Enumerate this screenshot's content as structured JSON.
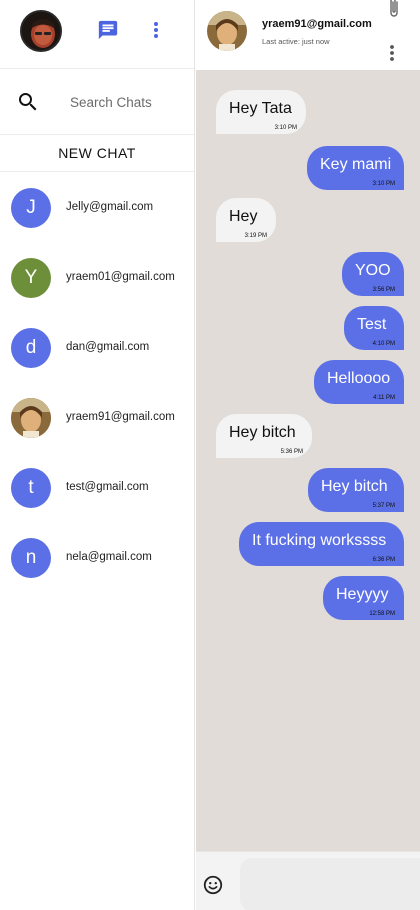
{
  "sidebar": {
    "search_placeholder": "Search Chats",
    "new_chat_label": "NEW CHAT",
    "items": [
      {
        "initial": "J",
        "label": "Jelly@gmail.com",
        "color": "#5b6fe6",
        "photo": false
      },
      {
        "initial": "Y",
        "label": "yraem01@gmail.com",
        "color": "#6e8f3a",
        "photo": false
      },
      {
        "initial": "d",
        "label": "dan@gmail.com",
        "color": "#5b6fe6",
        "photo": false
      },
      {
        "initial": "",
        "label": "yraem91@gmail.com",
        "color": "#b58b50",
        "photo": true
      },
      {
        "initial": "t",
        "label": "test@gmail.com",
        "color": "#5b6fe6",
        "photo": false
      },
      {
        "initial": "n",
        "label": "nela@gmail.com",
        "color": "#5b6fe6",
        "photo": false
      }
    ]
  },
  "chat": {
    "title": "yraem91@gmail.com",
    "status": "Last active: just now",
    "messages": [
      {
        "dir": "in",
        "text": "Hey Tata",
        "time": "3:10 PM"
      },
      {
        "dir": "out",
        "text": "Key mami",
        "time": "3:10 PM"
      },
      {
        "dir": "in",
        "text": "Hey",
        "time": "3:19 PM"
      },
      {
        "dir": "out",
        "text": "YOO",
        "time": "3:56 PM"
      },
      {
        "dir": "out",
        "text": "Test",
        "time": "4:10 PM"
      },
      {
        "dir": "out",
        "text": "Helloooo",
        "time": "4:11 PM"
      },
      {
        "dir": "in",
        "text": "Hey bitch",
        "time": "5:36 PM"
      },
      {
        "dir": "out",
        "text": "Hey bitch",
        "time": "5:37 PM"
      },
      {
        "dir": "out",
        "text": "It fucking workssss",
        "time": "6:36 PM"
      },
      {
        "dir": "out",
        "text": "Heyyyy",
        "time": "12:58 PM"
      }
    ]
  },
  "composer": {
    "placeholder": ""
  },
  "colors": {
    "accent": "#5b6fe6",
    "chat_background": "#e1dcd7",
    "incoming_bubble": "#f3f3f3"
  },
  "icons": {
    "chat": "chat-bubble-icon",
    "more": "more-vert-icon",
    "search": "search-icon",
    "attach": "paperclip-icon",
    "emoji": "emoji-icon"
  }
}
